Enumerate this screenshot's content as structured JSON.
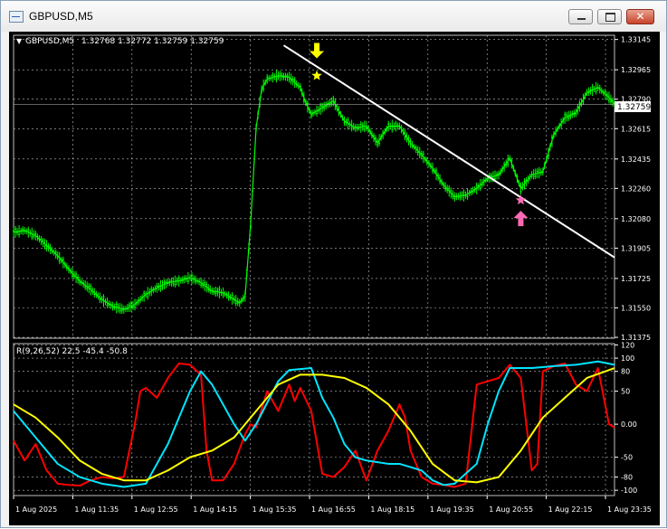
{
  "window": {
    "title": "GBPUSD,M5",
    "close_glyph": "✕",
    "icons": [
      "chart-window-icon",
      "minimize-icon",
      "maximize-icon",
      "close-icon"
    ]
  },
  "colors": {
    "background": "#000000",
    "candles": "#00ff00",
    "grid": "#c0c0c0",
    "axis_text": "#ffffff",
    "trendline": "#ffffff",
    "sell_arrow": "#ffff00",
    "buy_arrow": "#ff69b4",
    "line_red": "#ff0000",
    "line_cyan": "#00e5ff",
    "line_yellow": "#ffff00"
  },
  "chart_data": [
    {
      "type": "line",
      "title": "GBPUSD,M5",
      "ohlc_header": "1.32768 1.32772 1.32759 1.32759",
      "current_price": "1.32759",
      "ylim": [
        1.3137,
        1.3317
      ],
      "y_ticks": [
        "1.33145",
        "1.32965",
        "1.32790",
        "1.32615",
        "1.32435",
        "1.32260",
        "1.32080",
        "1.31905",
        "1.31725",
        "1.31550",
        "1.31375"
      ],
      "x_ticks": [
        "1 Aug 2025",
        "1 Aug 11:35",
        "1 Aug 12:55",
        "1 Aug 14:15",
        "1 Aug 15:35",
        "1 Aug 16:55",
        "1 Aug 18:15",
        "1 Aug 19:35",
        "1 Aug 20:55",
        "1 Aug 22:15",
        "1 Aug 23:35"
      ],
      "x_range": [
        0,
        109
      ],
      "price": [
        [
          0,
          1.32
        ],
        [
          2,
          1.3201
        ],
        [
          4,
          1.3198
        ],
        [
          6,
          1.3192
        ],
        [
          8,
          1.3186
        ],
        [
          10,
          1.3178
        ],
        [
          12,
          1.3171
        ],
        [
          14,
          1.3166
        ],
        [
          16,
          1.316
        ],
        [
          18,
          1.3156
        ],
        [
          20,
          1.3154
        ],
        [
          22,
          1.3157
        ],
        [
          24,
          1.3163
        ],
        [
          26,
          1.3167
        ],
        [
          28,
          1.317
        ],
        [
          30,
          1.3171
        ],
        [
          32,
          1.3173
        ],
        [
          34,
          1.317
        ],
        [
          36,
          1.3165
        ],
        [
          38,
          1.3164
        ],
        [
          40,
          1.316
        ],
        [
          41,
          1.3158
        ],
        [
          42,
          1.3162
        ],
        [
          43,
          1.3205
        ],
        [
          44,
          1.3262
        ],
        [
          45,
          1.3285
        ],
        [
          46,
          1.3291
        ],
        [
          48,
          1.3293
        ],
        [
          50,
          1.3292
        ],
        [
          52,
          1.3286
        ],
        [
          53,
          1.3277
        ],
        [
          54,
          1.327
        ],
        [
          56,
          1.3274
        ],
        [
          58,
          1.3278
        ],
        [
          60,
          1.3266
        ],
        [
          62,
          1.3262
        ],
        [
          64,
          1.3263
        ],
        [
          66,
          1.3253
        ],
        [
          68,
          1.3263
        ],
        [
          70,
          1.3263
        ],
        [
          72,
          1.3253
        ],
        [
          74,
          1.3246
        ],
        [
          76,
          1.3238
        ],
        [
          78,
          1.3228
        ],
        [
          80,
          1.3221
        ],
        [
          82,
          1.3222
        ],
        [
          84,
          1.3226
        ],
        [
          86,
          1.3232
        ],
        [
          88,
          1.3234
        ],
        [
          90,
          1.3244
        ],
        [
          92,
          1.3226
        ],
        [
          94,
          1.3234
        ],
        [
          96,
          1.3236
        ],
        [
          98,
          1.3258
        ],
        [
          100,
          1.3268
        ],
        [
          102,
          1.3271
        ],
        [
          104,
          1.3283
        ],
        [
          106,
          1.3286
        ],
        [
          108,
          1.328
        ],
        [
          109,
          1.3276
        ]
      ],
      "trendline": [
        [
          49,
          1.3311
        ],
        [
          109,
          1.3185
        ]
      ],
      "signals": [
        {
          "type": "sell-arrow",
          "x": 55,
          "y": 1.3306
        },
        {
          "type": "star-marker",
          "x": 55,
          "y": 1.3293
        },
        {
          "type": "buy-arrow",
          "x": 92,
          "y": 1.321
        },
        {
          "type": "star-marker",
          "x": 92,
          "y": 1.3219
        }
      ]
    },
    {
      "type": "line",
      "label": "R(9,26,52) 22.5 -45.4 -50.8",
      "ylim": [
        -108,
        122
      ],
      "y_ticks": [
        "120",
        "100",
        "80",
        "50",
        "0.00",
        "-50",
        "-80",
        "-100"
      ],
      "y_tick_values": [
        120,
        100,
        80,
        50,
        0,
        -50,
        -80,
        -100
      ],
      "series": [
        {
          "color": "red",
          "values": [
            [
              0,
              -25
            ],
            [
              2,
              -55
            ],
            [
              4,
              -30
            ],
            [
              6,
              -70
            ],
            [
              8,
              -90
            ],
            [
              10,
              -92
            ],
            [
              12,
              -93
            ],
            [
              14,
              -85
            ],
            [
              16,
              -80
            ],
            [
              18,
              -82
            ],
            [
              20,
              -80
            ],
            [
              22,
              0
            ],
            [
              23,
              50
            ],
            [
              24,
              55
            ],
            [
              26,
              40
            ],
            [
              28,
              70
            ],
            [
              30,
              92
            ],
            [
              32,
              90
            ],
            [
              34,
              75
            ],
            [
              35,
              -40
            ],
            [
              36,
              -85
            ],
            [
              38,
              -85
            ],
            [
              40,
              -60
            ],
            [
              42,
              -15
            ],
            [
              43,
              0
            ],
            [
              44,
              -5
            ],
            [
              46,
              50
            ],
            [
              48,
              20
            ],
            [
              50,
              60
            ],
            [
              51,
              35
            ],
            [
              52,
              55
            ],
            [
              54,
              20
            ],
            [
              56,
              -75
            ],
            [
              58,
              -80
            ],
            [
              60,
              -65
            ],
            [
              62,
              -40
            ],
            [
              64,
              -85
            ],
            [
              66,
              -40
            ],
            [
              68,
              -10
            ],
            [
              70,
              30
            ],
            [
              71,
              10
            ],
            [
              72,
              -40
            ],
            [
              74,
              -80
            ],
            [
              76,
              -90
            ],
            [
              78,
              -92
            ],
            [
              80,
              -95
            ],
            [
              82,
              -90
            ],
            [
              84,
              60
            ],
            [
              86,
              65
            ],
            [
              88,
              70
            ],
            [
              90,
              90
            ],
            [
              92,
              70
            ],
            [
              94,
              -70
            ],
            [
              95,
              -60
            ],
            [
              96,
              80
            ],
            [
              98,
              88
            ],
            [
              100,
              92
            ],
            [
              102,
              60
            ],
            [
              104,
              50
            ],
            [
              106,
              85
            ],
            [
              108,
              0
            ],
            [
              109,
              -5
            ]
          ]
        },
        {
          "color": "cyan",
          "values": [
            [
              0,
              20
            ],
            [
              4,
              -20
            ],
            [
              8,
              -60
            ],
            [
              12,
              -80
            ],
            [
              16,
              -90
            ],
            [
              20,
              -95
            ],
            [
              24,
              -90
            ],
            [
              28,
              -30
            ],
            [
              32,
              50
            ],
            [
              34,
              80
            ],
            [
              36,
              60
            ],
            [
              40,
              0
            ],
            [
              42,
              -25
            ],
            [
              44,
              0
            ],
            [
              48,
              65
            ],
            [
              50,
              82
            ],
            [
              54,
              85
            ],
            [
              56,
              40
            ],
            [
              58,
              10
            ],
            [
              60,
              -30
            ],
            [
              62,
              -50
            ],
            [
              64,
              -55
            ],
            [
              68,
              -60
            ],
            [
              70,
              -60
            ],
            [
              72,
              -65
            ],
            [
              74,
              -70
            ],
            [
              76,
              -85
            ],
            [
              78,
              -92
            ],
            [
              80,
              -90
            ],
            [
              84,
              -60
            ],
            [
              86,
              0
            ],
            [
              88,
              50
            ],
            [
              90,
              85
            ],
            [
              94,
              85
            ],
            [
              98,
              88
            ],
            [
              102,
              90
            ],
            [
              106,
              95
            ],
            [
              109,
              90
            ]
          ]
        },
        {
          "color": "yellow",
          "values": [
            [
              0,
              30
            ],
            [
              4,
              10
            ],
            [
              8,
              -20
            ],
            [
              12,
              -55
            ],
            [
              16,
              -75
            ],
            [
              20,
              -85
            ],
            [
              24,
              -85
            ],
            [
              28,
              -70
            ],
            [
              32,
              -50
            ],
            [
              36,
              -40
            ],
            [
              40,
              -20
            ],
            [
              44,
              20
            ],
            [
              48,
              60
            ],
            [
              52,
              75
            ],
            [
              56,
              75
            ],
            [
              60,
              70
            ],
            [
              64,
              55
            ],
            [
              68,
              30
            ],
            [
              72,
              -10
            ],
            [
              76,
              -60
            ],
            [
              80,
              -85
            ],
            [
              84,
              -88
            ],
            [
              88,
              -80
            ],
            [
              92,
              -40
            ],
            [
              96,
              10
            ],
            [
              100,
              40
            ],
            [
              104,
              70
            ],
            [
              109,
              85
            ]
          ]
        }
      ]
    }
  ]
}
